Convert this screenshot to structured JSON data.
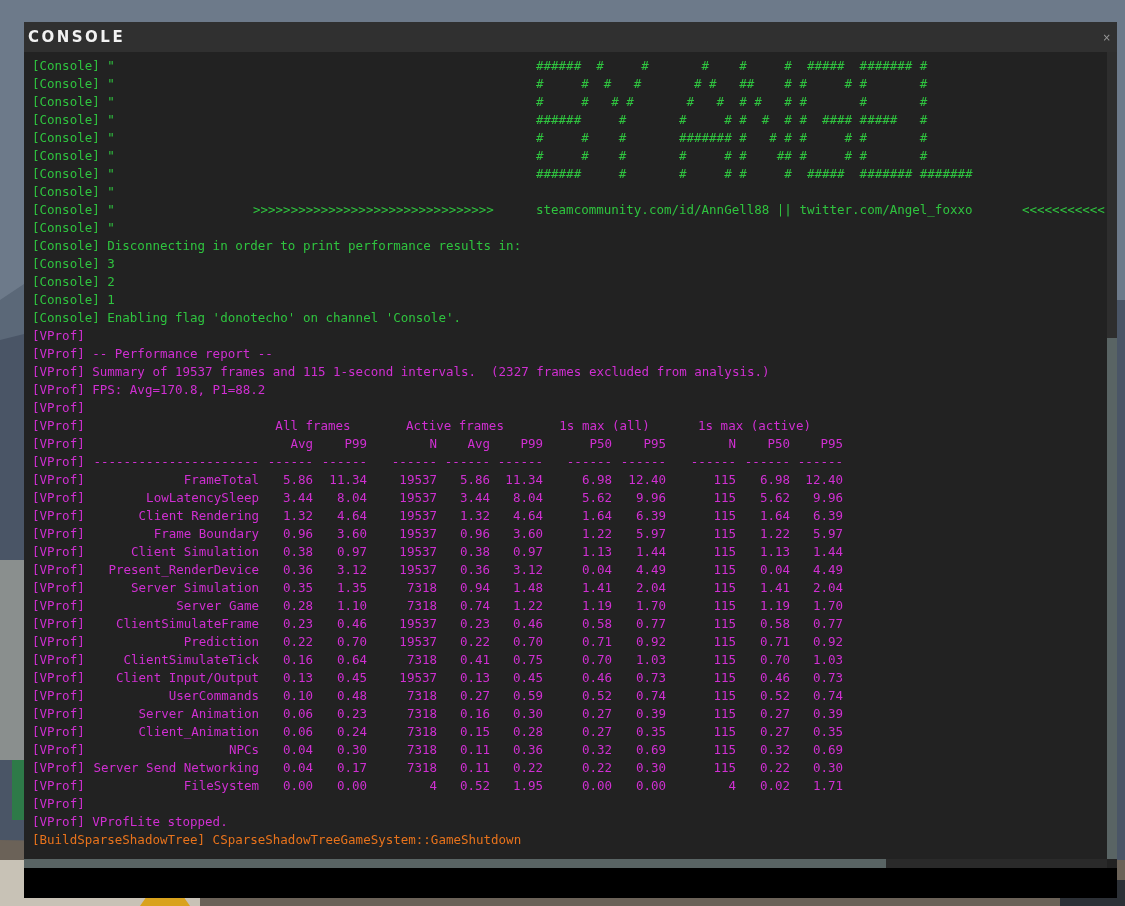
{
  "window": {
    "title": "CONSOLE",
    "close": "×"
  },
  "log_before": [
    {
      "kind": "art",
      "color": "#2fc43f",
      "prefix": "[Console] \"",
      "art": "######  #     #       #    #     #  #####  ####### #"
    },
    {
      "kind": "art",
      "color": "#2fc43f",
      "prefix": "[Console] \"",
      "art": "#     #  #   #       # #   ##    # #     # #       #"
    },
    {
      "kind": "art",
      "color": "#2fc43f",
      "prefix": "[Console] \"",
      "art": "#     #   # #       #   #  # #   # #       #       #"
    },
    {
      "kind": "art",
      "color": "#2fc43f",
      "prefix": "[Console] \"",
      "art": "######     #       #     # #  #  # #  #### #####   #"
    },
    {
      "kind": "art",
      "color": "#2fc43f",
      "prefix": "[Console] \"",
      "art": "#     #    #       ####### #   # # #     # #       #"
    },
    {
      "kind": "art",
      "color": "#2fc43f",
      "prefix": "[Console] \"",
      "art": "#     #    #       #     # #    ## #     # #       #"
    },
    {
      "kind": "art",
      "color": "#2fc43f",
      "prefix": "[Console] \"",
      "art": "######     #       #     # #     #  #####  ####### #######"
    },
    {
      "kind": "text",
      "color": "#2fc43f",
      "text": "[Console] \""
    },
    {
      "kind": "banner",
      "color": "#2fc43f",
      "prefix": "[Console] \"",
      "arrows": ">>>>>>>>>>>>>>>>>>>>>>>>>>>>>>>>",
      "links": "steamcommunity.com/id/AnnGell88 || twitter.com/Angel_foxxo",
      "tail": "<<<<<<<<<<<"
    },
    {
      "kind": "text",
      "color": "#2fc43f",
      "text": "[Console] \""
    },
    {
      "kind": "text",
      "color": "#2fc43f",
      "text": "[Console] Disconnecting in order to print performance results in:"
    },
    {
      "kind": "text",
      "color": "#2fc43f",
      "text": "[Console] 3"
    },
    {
      "kind": "text",
      "color": "#2fc43f",
      "text": "[Console] 2"
    },
    {
      "kind": "text",
      "color": "#2fc43f",
      "text": "[Console] 1"
    },
    {
      "kind": "text",
      "color": "#2fc43f",
      "text": "[Console] Enabling flag 'donotecho' on channel 'Console'."
    },
    {
      "kind": "text",
      "color": "#d02fd2",
      "text": "[VProf]"
    },
    {
      "kind": "text",
      "color": "#d02fd2",
      "text": "[VProf] -- Performance report --"
    },
    {
      "kind": "text",
      "color": "#d02fd2",
      "text": "[VProf] Summary of 19537 frames and 115 1-second intervals.  (2327 frames excluded from analysis.)"
    },
    {
      "kind": "text",
      "color": "#d02fd2",
      "text": "[VProf] FPS: Avg=170.8, P1=88.2"
    },
    {
      "kind": "text",
      "color": "#d02fd2",
      "text": "[VProf]"
    }
  ],
  "report": {
    "color": "#d02fd2",
    "group_row": {
      "prefix": "[VProf]",
      "labels": [
        "All frames",
        "Active frames",
        "1s max (all)",
        "1s max (active)"
      ]
    },
    "header_row": {
      "prefix": "[VProf]",
      "labels": [
        "Avg",
        "P99",
        "N",
        "Avg",
        "P99",
        "P50",
        "P95",
        "N",
        "P50",
        "P95"
      ]
    },
    "separator_row": {
      "prefix": "[VProf]",
      "labels": [
        "----------------------",
        "------",
        "------",
        "------",
        "------",
        "------",
        "------",
        "------",
        "------",
        "------",
        "------"
      ]
    },
    "rows": [
      {
        "prefix": "[VProf]",
        "name": "FrameTotal",
        "values": [
          "5.86",
          "11.34",
          "19537",
          "5.86",
          "11.34",
          "6.98",
          "12.40",
          "115",
          "6.98",
          "12.40"
        ]
      },
      {
        "prefix": "[VProf]",
        "name": "LowLatencySleep",
        "values": [
          "3.44",
          "8.04",
          "19537",
          "3.44",
          "8.04",
          "5.62",
          "9.96",
          "115",
          "5.62",
          "9.96"
        ]
      },
      {
        "prefix": "[VProf]",
        "name": "Client Rendering",
        "values": [
          "1.32",
          "4.64",
          "19537",
          "1.32",
          "4.64",
          "1.64",
          "6.39",
          "115",
          "1.64",
          "6.39"
        ]
      },
      {
        "prefix": "[VProf]",
        "name": "Frame Boundary",
        "values": [
          "0.96",
          "3.60",
          "19537",
          "0.96",
          "3.60",
          "1.22",
          "5.97",
          "115",
          "1.22",
          "5.97"
        ]
      },
      {
        "prefix": "[VProf]",
        "name": "Client Simulation",
        "values": [
          "0.38",
          "0.97",
          "19537",
          "0.38",
          "0.97",
          "1.13",
          "1.44",
          "115",
          "1.13",
          "1.44"
        ]
      },
      {
        "prefix": "[VProf]",
        "name": "Present_RenderDevice",
        "values": [
          "0.36",
          "3.12",
          "19537",
          "0.36",
          "3.12",
          "0.04",
          "4.49",
          "115",
          "0.04",
          "4.49"
        ]
      },
      {
        "prefix": "[VProf]",
        "name": "Server Simulation",
        "values": [
          "0.35",
          "1.35",
          "7318",
          "0.94",
          "1.48",
          "1.41",
          "2.04",
          "115",
          "1.41",
          "2.04"
        ]
      },
      {
        "prefix": "[VProf]",
        "name": "Server Game",
        "values": [
          "0.28",
          "1.10",
          "7318",
          "0.74",
          "1.22",
          "1.19",
          "1.70",
          "115",
          "1.19",
          "1.70"
        ]
      },
      {
        "prefix": "[VProf]",
        "name": "ClientSimulateFrame",
        "values": [
          "0.23",
          "0.46",
          "19537",
          "0.23",
          "0.46",
          "0.58",
          "0.77",
          "115",
          "0.58",
          "0.77"
        ]
      },
      {
        "prefix": "[VProf]",
        "name": "Prediction",
        "values": [
          "0.22",
          "0.70",
          "19537",
          "0.22",
          "0.70",
          "0.71",
          "0.92",
          "115",
          "0.71",
          "0.92"
        ]
      },
      {
        "prefix": "[VProf]",
        "name": "ClientSimulateTick",
        "values": [
          "0.16",
          "0.64",
          "7318",
          "0.41",
          "0.75",
          "0.70",
          "1.03",
          "115",
          "0.70",
          "1.03"
        ]
      },
      {
        "prefix": "[VProf]",
        "name": "Client Input/Output",
        "values": [
          "0.13",
          "0.45",
          "19537",
          "0.13",
          "0.45",
          "0.46",
          "0.73",
          "115",
          "0.46",
          "0.73"
        ]
      },
      {
        "prefix": "[VProf]",
        "name": "UserCommands",
        "values": [
          "0.10",
          "0.48",
          "7318",
          "0.27",
          "0.59",
          "0.52",
          "0.74",
          "115",
          "0.52",
          "0.74"
        ]
      },
      {
        "prefix": "[VProf]",
        "name": "Server Animation",
        "values": [
          "0.06",
          "0.23",
          "7318",
          "0.16",
          "0.30",
          "0.27",
          "0.39",
          "115",
          "0.27",
          "0.39"
        ]
      },
      {
        "prefix": "[VProf]",
        "name": "Client_Animation",
        "values": [
          "0.06",
          "0.24",
          "7318",
          "0.15",
          "0.28",
          "0.27",
          "0.35",
          "115",
          "0.27",
          "0.35"
        ]
      },
      {
        "prefix": "[VProf]",
        "name": "NPCs",
        "values": [
          "0.04",
          "0.30",
          "7318",
          "0.11",
          "0.36",
          "0.32",
          "0.69",
          "115",
          "0.32",
          "0.69"
        ]
      },
      {
        "prefix": "[VProf]",
        "name": "Server Send Networking",
        "values": [
          "0.04",
          "0.17",
          "7318",
          "0.11",
          "0.22",
          "0.22",
          "0.30",
          "115",
          "0.22",
          "0.30"
        ]
      },
      {
        "prefix": "[VProf]",
        "name": "FileSystem",
        "values": [
          "0.00",
          "0.00",
          "4",
          "0.52",
          "1.95",
          "0.00",
          "0.00",
          "4",
          "0.02",
          "1.71"
        ]
      }
    ]
  },
  "log_after": [
    {
      "kind": "text",
      "color": "#d02fd2",
      "text": "[VProf]"
    },
    {
      "kind": "text",
      "color": "#d02fd2",
      "text": "[VProf] VProfLite stopped."
    },
    {
      "kind": "text",
      "color": "#e8731c",
      "text": "[BuildSparseShadowTree] CSparseShadowTreeGameSystem::GameShutdown"
    }
  ]
}
